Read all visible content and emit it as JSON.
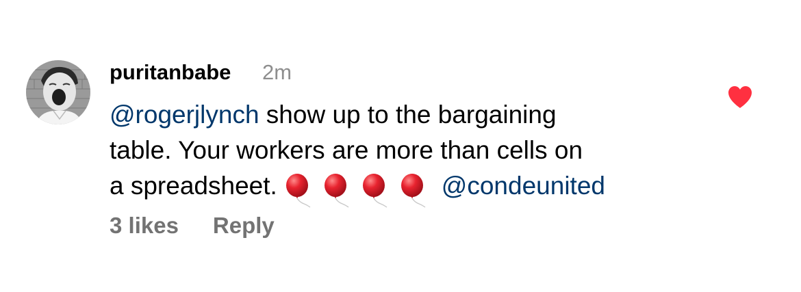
{
  "comment": {
    "username": "puritanbabe",
    "timestamp": "2m",
    "text": {
      "mention_1": "@rogerjlynch",
      "line_1_rest": " show up to the bargaining",
      "line_2": "table. Your workers are more than cells on",
      "line_3": "a spreadsheet.",
      "emoji": [
        "balloon",
        "balloon",
        "balloon",
        "balloon"
      ],
      "mention_2": "@condeunited"
    },
    "likes": "3 likes",
    "reply_label": "Reply",
    "liked": true,
    "icons": {
      "like": "heart-icon",
      "emoji": "balloon-icon",
      "avatar": "profile-photo"
    },
    "colors": {
      "mention": "#00376b",
      "meta": "#737373",
      "timestamp": "#8e8e8e",
      "heart": "#ff3040",
      "balloon": "#e8232f"
    }
  }
}
